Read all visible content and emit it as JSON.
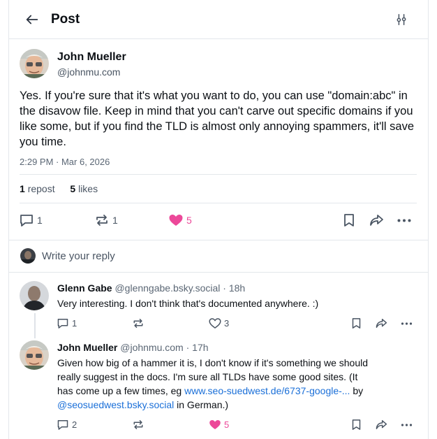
{
  "header": {
    "title": "Post"
  },
  "post": {
    "author_name": "John Mueller",
    "author_handle": "@johnmu.com",
    "text": "Yes. If you're sure that it's what you want to do, you can use \"domain:abc\" in the disavow file. Keep in mind that you can't carve out specific domains if you like some, but if you find the TLD is almost only annoying spammers, it'll save you time.",
    "timestamp": "2:29 PM · Mar 6, 2026",
    "repost_count": "1",
    "repost_label": "repost",
    "like_count": "5",
    "like_label": "likes",
    "actions": {
      "replies": "1",
      "reposts": "1",
      "likes": "5"
    }
  },
  "reply_box": {
    "placeholder": "Write your reply"
  },
  "replies": [
    {
      "name": "Glenn Gabe",
      "handle": "@glenngabe.bsky.social",
      "age": "· 18h",
      "text": "Very interesting. I don't think that's documented anywhere. :)",
      "replies": "1",
      "likes": "3"
    },
    {
      "name": "John Mueller",
      "handle": "@johnmu.com",
      "age": "· 17h",
      "text_line1": "Given how big of a hammer it is, I don't know if it's something we should",
      "text_line2": "really suggest in the docs. I'm sure all TLDs have some good sites. (It",
      "text_line3a": "has come up a few times, eg ",
      "link": "www.seo-suedwest.de/6737-google-...",
      "text_line3b": " by",
      "mention": "@seosuedwest.bsky.social",
      "text_line4": " in German.)",
      "replies": "2",
      "likes": "5"
    }
  ],
  "colors": {
    "accent": "#1a6fd8",
    "like": "#ec4899",
    "border": "#e3e7eb"
  }
}
